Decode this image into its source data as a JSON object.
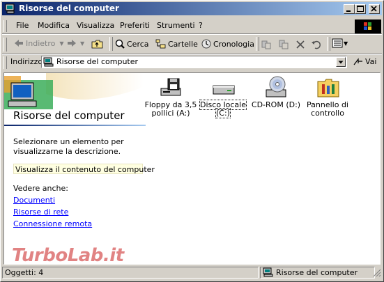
{
  "window": {
    "title": "Risorse del computer"
  },
  "menu": [
    "File",
    "Modifica",
    "Visualizza",
    "Preferiti",
    "Strumenti",
    "?"
  ],
  "toolbar": {
    "back": "Indietro",
    "search": "Cerca",
    "folders": "Cartelle",
    "history": "Cronologia"
  },
  "address": {
    "label": "Indirizzo",
    "value": "Risorse del computer",
    "go": "Vai"
  },
  "left_pane": {
    "title": "Risorse del computer",
    "description": "Selezionare un elemento per visualizzarne la descrizione.",
    "hint": "Visualizza il contenuto del computer",
    "see_also": "Vedere anche:",
    "links": [
      "Documenti",
      "Risorse di rete",
      "Connessione remota"
    ]
  },
  "items": [
    {
      "label_line1": "Floppy da 3,5",
      "label_line2": "pollici (A:)",
      "icon": "floppy-drive-icon"
    },
    {
      "label_line1": "Disco locale",
      "label_line2": "(C:)",
      "icon": "hard-disk-icon"
    },
    {
      "label_line1": "CD-ROM (D:)",
      "label_line2": "",
      "icon": "cdrom-icon"
    },
    {
      "label_line1": "Pannello di",
      "label_line2": "controllo",
      "icon": "control-panel-icon"
    }
  ],
  "status": {
    "objects": "Oggetti: 4",
    "location": "Risorse del computer"
  },
  "watermark": "TurboLab.it",
  "colors": {
    "titlebar_start": "#0a246a",
    "titlebar_end": "#a6caf0",
    "link": "#0000ff",
    "chrome": "#d4d0c8"
  }
}
